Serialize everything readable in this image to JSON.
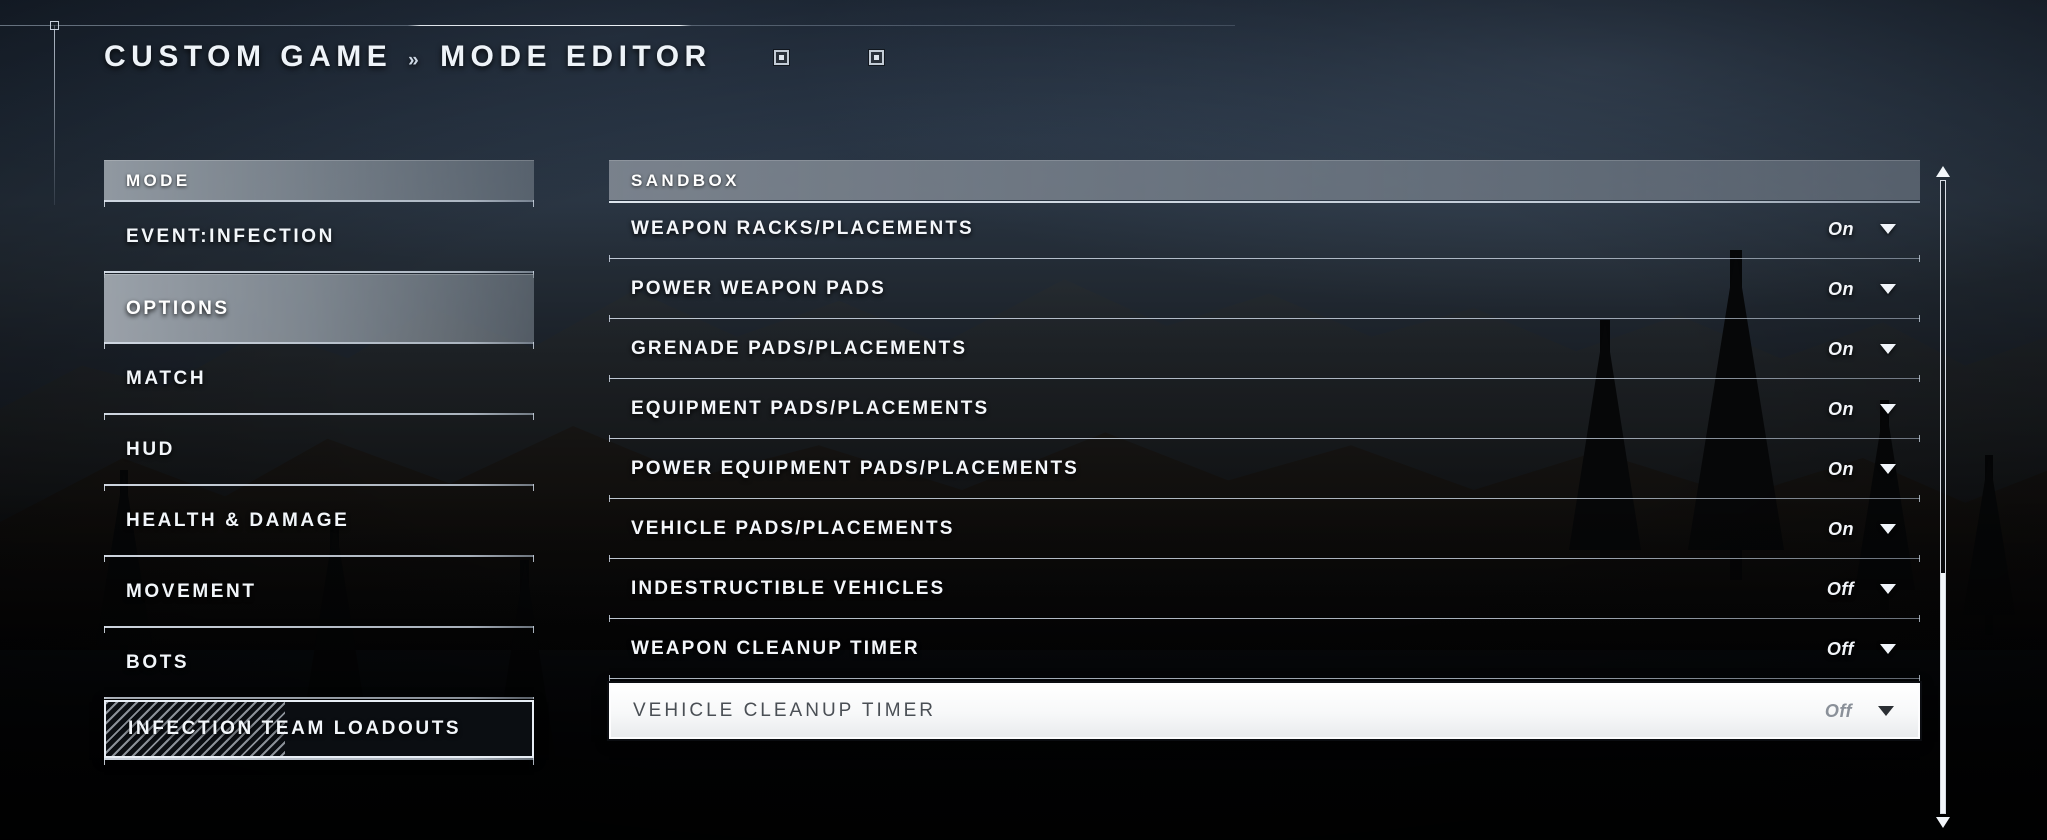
{
  "header": {
    "breadcrumb_root": "CUSTOM GAME",
    "breadcrumb_separator": "»",
    "breadcrumb_current": "MODE EDITOR",
    "button_prompt_1": "button-prompt",
    "button_prompt_2": "button-prompt"
  },
  "sidebar": {
    "title": "MODE",
    "items": [
      {
        "label": "EVENT:INFECTION",
        "state": "normal"
      },
      {
        "label": "OPTIONS",
        "state": "selected"
      },
      {
        "label": "MATCH",
        "state": "normal"
      },
      {
        "label": "HUD",
        "state": "normal"
      },
      {
        "label": "HEALTH & DAMAGE",
        "state": "normal"
      },
      {
        "label": "MOVEMENT",
        "state": "normal"
      },
      {
        "label": "BOTS",
        "state": "normal"
      },
      {
        "label": "INFECTION TEAM LOADOUTS",
        "state": "focused"
      }
    ]
  },
  "main": {
    "title": "SANDBOX",
    "rows": [
      {
        "name": "WEAPON RACKS/PLACEMENTS",
        "value": "On",
        "state": "normal"
      },
      {
        "name": "POWER WEAPON PADS",
        "value": "On",
        "state": "normal"
      },
      {
        "name": "GRENADE PADS/PLACEMENTS",
        "value": "On",
        "state": "normal"
      },
      {
        "name": "EQUIPMENT PADS/PLACEMENTS",
        "value": "On",
        "state": "normal"
      },
      {
        "name": "POWER EQUIPMENT PADS/PLACEMENTS",
        "value": "On",
        "state": "normal"
      },
      {
        "name": "VEHICLE PADS/PLACEMENTS",
        "value": "On",
        "state": "normal"
      },
      {
        "name": "INDESTRUCTIBLE VEHICLES",
        "value": "Off",
        "state": "normal"
      },
      {
        "name": "WEAPON CLEANUP TIMER",
        "value": "Off",
        "state": "normal"
      },
      {
        "name": "VEHICLE CLEANUP TIMER",
        "value": "Off",
        "state": "selected"
      }
    ]
  },
  "scrollbar": {
    "up_arrow": "scroll-up-arrow",
    "down_arrow": "scroll-down-arrow"
  },
  "colors": {
    "accent_light": "#eef3f8",
    "panel_gray": "#808892",
    "selected_bg": "#ffffff",
    "background_dark": "#0a0d12"
  }
}
